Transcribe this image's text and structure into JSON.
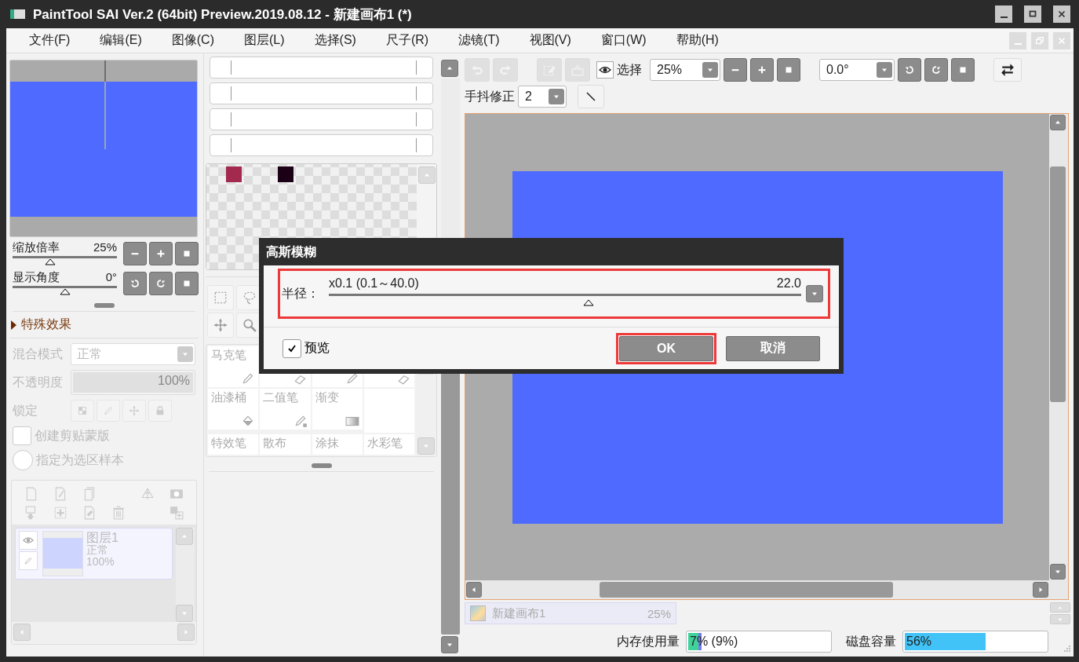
{
  "window": {
    "title": "PaintTool SAI Ver.2 (64bit) Preview.2019.08.12 - 新建画布1 (*)"
  },
  "menu": [
    "文件(F)",
    "编辑(E)",
    "图像(C)",
    "图层(L)",
    "选择(S)",
    "尺子(R)",
    "滤镜(T)",
    "视图(V)",
    "窗口(W)",
    "帮助(H)"
  ],
  "navigator": {
    "zoom": {
      "label": "缩放倍率",
      "value": "25%",
      "level": 0.36
    },
    "angle": {
      "label": "显示角度",
      "value": "0°",
      "level": 0.5
    }
  },
  "effects": {
    "title": "特殊效果",
    "expanded": false
  },
  "layer_props": {
    "disabled": true,
    "blend_label": "混合模式",
    "blend_value": "正常",
    "opacity_label": "不透明度",
    "opacity_value": "100%",
    "lock_label": "锁定",
    "clip": {
      "label": "创建剪贴蒙版",
      "checked": false
    },
    "sample": {
      "label": "指定为选区样本",
      "selected": false
    }
  },
  "layers": [
    {
      "name": "图层1",
      "mode": "正常",
      "opacity": "100%",
      "selected": true
    }
  ],
  "swatches": [
    {
      "kind": "empty"
    },
    {
      "kind": "color",
      "color": "#a3294f"
    },
    {
      "kind": "empty"
    },
    {
      "kind": "empty"
    },
    {
      "kind": "color",
      "color": "#1c0016"
    }
  ],
  "tools": [
    {
      "kind": "marker",
      "label": "马克笔"
    },
    {
      "kind": "eraser"
    },
    {
      "kind": "select-pen"
    },
    {
      "kind": "select-eraser"
    },
    {
      "kind": "bucket",
      "label": "油漆桶"
    },
    {
      "kind": "binary",
      "label": "二值笔"
    },
    {
      "kind": "gradient",
      "label": "渐变"
    },
    {
      "kind": "empty"
    },
    {
      "kind": "text",
      "label": "特效笔"
    },
    {
      "kind": "text",
      "label": "散布"
    },
    {
      "kind": "text",
      "label": "涂抹"
    },
    {
      "kind": "text",
      "label": "水彩笔"
    }
  ],
  "canvas_toolbar": {
    "selection_label": "选择",
    "zoom_value": "25%",
    "angle_value": "0.0°",
    "stabilizer_label": "手抖修正",
    "stabilizer_value": "2",
    "history": [
      {
        "kind": "undo",
        "disabled": true
      },
      {
        "kind": "redo",
        "disabled": true
      },
      {
        "kind": "deselect",
        "disabled": true
      },
      {
        "kind": "clear",
        "disabled": true
      }
    ]
  },
  "canvas_tabs": [
    {
      "name": "新建画布1",
      "zoom": "25%",
      "selected": true
    }
  ],
  "status": {
    "memory": {
      "label": "内存使用量",
      "reading": "7% (9%)",
      "level": 0.09
    },
    "disk": {
      "label": "磁盘容量",
      "reading": "56%",
      "level": 0.56
    }
  },
  "dialog": {
    "title": "高斯模糊",
    "radius": {
      "label": "半径：",
      "range": "x0.1 (0.1～40.0)",
      "reading": "22.0",
      "level": 0.55,
      "highlighted": true
    },
    "preview": {
      "label": "预览",
      "checked": true
    },
    "buttons": [
      {
        "label": "OK",
        "highlighted": true
      },
      {
        "label": "取消",
        "highlighted": false
      }
    ]
  }
}
